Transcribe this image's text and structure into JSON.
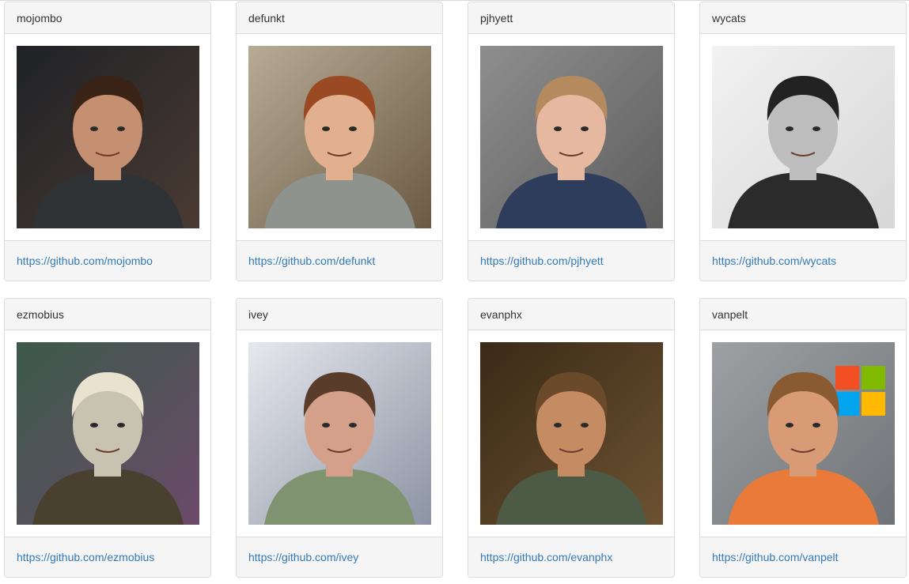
{
  "users": [
    {
      "login": "mojombo",
      "url": "https://github.com/mojombo",
      "avatar": {
        "bg1": "#1f2226",
        "bg2": "#4a3a33",
        "skin": "#c58f72",
        "hair": "#3a2418",
        "shirt": "#2f3336"
      }
    },
    {
      "login": "defunkt",
      "url": "https://github.com/defunkt",
      "avatar": {
        "bg1": "#b7ab95",
        "bg2": "#6b5a43",
        "skin": "#e2b08e",
        "hair": "#9a4a22",
        "shirt": "#8e938d"
      }
    },
    {
      "login": "pjhyett",
      "url": "https://github.com/pjhyett",
      "avatar": {
        "bg1": "#8e8e8e",
        "bg2": "#5d5d5d",
        "skin": "#e7b8a0",
        "hair": "#b48a5e",
        "shirt": "#2e3d5b"
      }
    },
    {
      "login": "wycats",
      "url": "https://github.com/wycats",
      "avatar": {
        "bg1": "#f2f2f2",
        "bg2": "#d7d7d7",
        "skin": "#bdbdbd",
        "hair": "#222222",
        "shirt": "#2b2b2b"
      }
    },
    {
      "login": "ezmobius",
      "url": "https://github.com/ezmobius",
      "avatar": {
        "bg1": "#3c5a4a",
        "bg2": "#6b4a6a",
        "skin": "#c8c2b0",
        "hair": "#e8e2cf",
        "shirt": "#4a4030"
      }
    },
    {
      "login": "ivey",
      "url": "https://github.com/ivey",
      "avatar": {
        "bg1": "#e6e8ee",
        "bg2": "#8c93a3",
        "skin": "#d4a08a",
        "hair": "#5a3c2a",
        "shirt": "#7f9370"
      }
    },
    {
      "login": "evanphx",
      "url": "https://github.com/evanphx",
      "avatar": {
        "bg1": "#3a2a16",
        "bg2": "#6c5232",
        "skin": "#c58b62",
        "hair": "#6a4a2a",
        "shirt": "#4d5a45"
      }
    },
    {
      "login": "vanpelt",
      "url": "https://github.com/vanpelt",
      "avatar": {
        "bg1": "#9ea1a3",
        "bg2": "#6f7377",
        "skin": "#d99b75",
        "hair": "#8a5a32",
        "shirt": "#e97a3a",
        "logo": [
          "#f25022",
          "#7fba00",
          "#00a4ef",
          "#ffb900"
        ]
      }
    }
  ]
}
